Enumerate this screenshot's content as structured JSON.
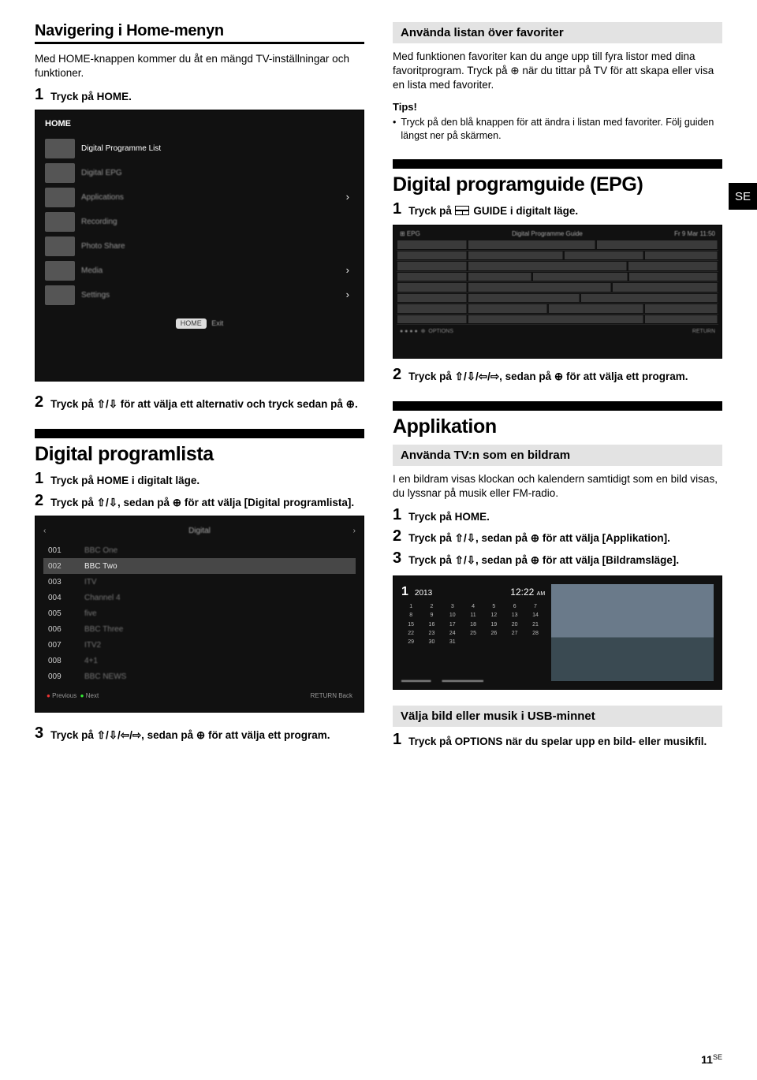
{
  "left": {
    "title1": "Navigering i Home-menyn",
    "intro1": "Med HOME-knappen kommer du åt en mängd TV-inställningar och funktioner.",
    "step1": "Tryck på HOME.",
    "home_label": "HOME",
    "menu_items": [
      "Digital Programme List",
      "Digital EPG",
      "Applications",
      "Recording",
      "Photo Share",
      "Media",
      "Settings"
    ],
    "home_button": "HOME",
    "step2": "Tryck på ⇧/⇩ för att välja ett alternativ och tryck sedan på ⊕.",
    "title2": "Digital programlista",
    "dpl_step1": "Tryck på HOME i digitalt läge.",
    "dpl_step2": "Tryck på ⇧/⇩, sedan på ⊕ för att välja [Digital programlista].",
    "list_rows": [
      {
        "ch": "001",
        "nm": "BBC One"
      },
      {
        "ch": "002",
        "nm": "BBC Two"
      },
      {
        "ch": "003",
        "nm": "ITV"
      },
      {
        "ch": "004",
        "nm": "Channel 4"
      },
      {
        "ch": "005",
        "nm": "five"
      },
      {
        "ch": "006",
        "nm": "BBC Three"
      },
      {
        "ch": "007",
        "nm": "ITV2"
      },
      {
        "ch": "008",
        "nm": "4+1"
      },
      {
        "ch": "009",
        "nm": "BBC NEWS"
      }
    ],
    "list_prev": "Previous",
    "list_next": "Next",
    "list_return": "RETURN  Back",
    "dpl_step3": "Tryck på ⇧/⇩/⇦/⇨, sedan på ⊕ för att välja ett program."
  },
  "right": {
    "fav_title": "Använda listan över favoriter",
    "fav_p1": "Med funktionen favoriter kan du ange upp till fyra listor med dina favoritprogram. Tryck på ⊕ när du tittar på TV för att skapa eller visa en lista med favoriter.",
    "tips_label": "Tips!",
    "tips_bullet": "Tryck på den blå knappen för att ändra i listan med favoriter. Följ guiden längst ner på skärmen.",
    "epg_title": "Digital programguide (EPG)",
    "epg_step1_a": "Tryck på ",
    "epg_step1_b": " GUIDE i digitalt läge.",
    "epg_step2": "Tryck på ⇧/⇩/⇦/⇨, sedan på ⊕ för att välja ett program.",
    "app_title": "Applikation",
    "app_sub": "Använda TV:n som en bildram",
    "app_p": "I en bildram visas klockan och kalendern samtidigt som en bild visas, du lyssnar på musik eller FM-radio.",
    "app_s1": "Tryck på HOME.",
    "app_s2": "Tryck på ⇧/⇩, sedan på ⊕ för att välja [Applikation].",
    "app_s3": "Tryck på ⇧/⇩, sedan på ⊕ för att välja [Bildramsläge].",
    "cal_big": "1",
    "cal_year": "2013",
    "cal_time": "12:22",
    "cal_ampm": "AM",
    "cal_days": [
      "1",
      "2",
      "3",
      "4",
      "5",
      "6",
      "7",
      "8",
      "9",
      "10",
      "11",
      "12",
      "13",
      "14",
      "15",
      "16",
      "17",
      "18",
      "19",
      "20",
      "21",
      "22",
      "23",
      "24",
      "25",
      "26",
      "27",
      "28",
      "29",
      "30",
      "31"
    ],
    "usb_title": "Välja bild eller musik i USB-minnet",
    "usb_s1": "Tryck på OPTIONS när du spelar upp en bild- eller musikfil.",
    "se": "SE",
    "page": "11",
    "page_sup": "SE"
  }
}
